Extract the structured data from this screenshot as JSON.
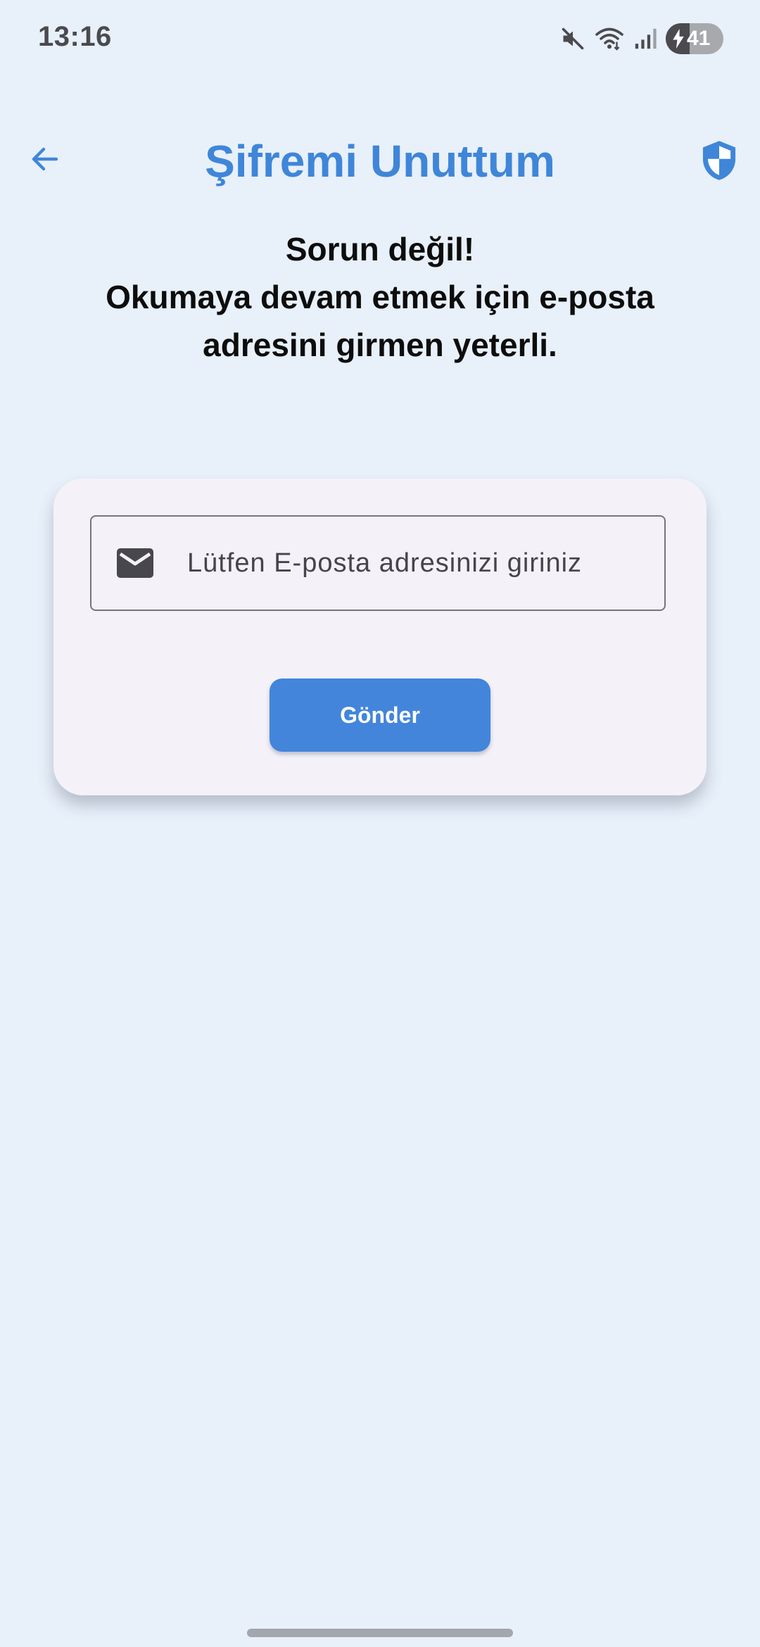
{
  "status_bar": {
    "time": "13:16",
    "battery_level": "41",
    "icons": [
      "mute-icon",
      "wifi-icon",
      "signal-icon",
      "battery-icon"
    ]
  },
  "app_bar": {
    "title": "Şifremi Unuttum",
    "back_icon": "arrow-back-icon",
    "security_icon": "shield-icon"
  },
  "heading": {
    "line1": "Sorun değil!",
    "line2": "Okumaya devam etmek için e-posta",
    "line3": "adresini girmen yeterli."
  },
  "form": {
    "email_placeholder": "Lütfen E-posta adresinizi giriniz",
    "email_value": "",
    "email_icon": "mail-icon",
    "submit_label": "Gönder"
  },
  "colors": {
    "background": "#e8f0fa",
    "accent": "#3f86d9",
    "button": "#4285db",
    "card": "#f4f2f8"
  }
}
